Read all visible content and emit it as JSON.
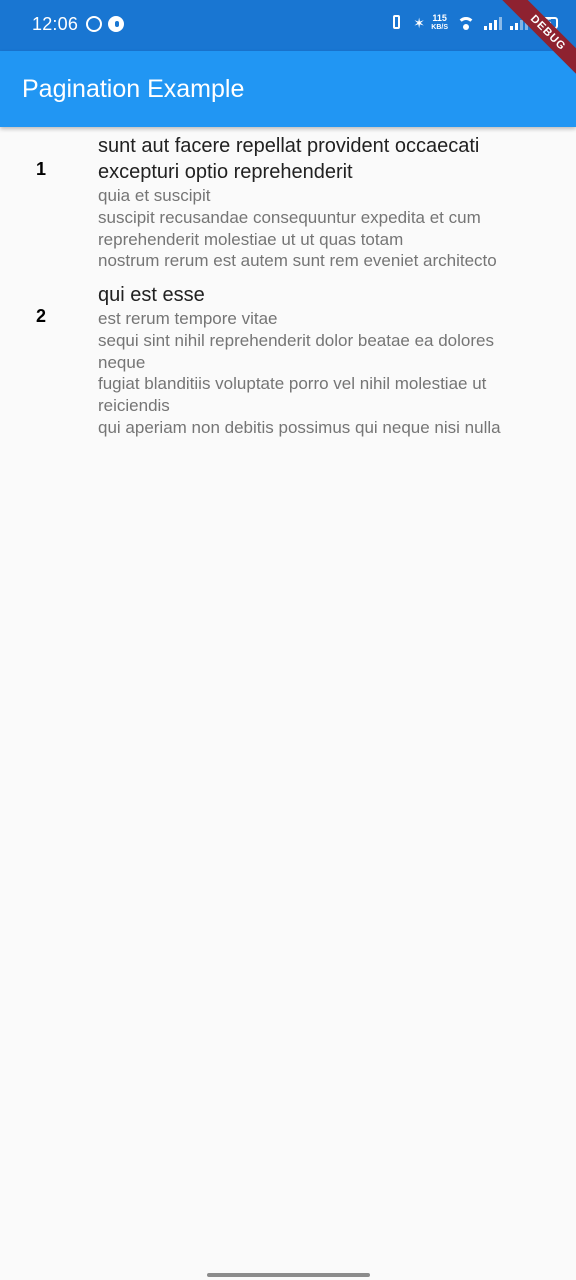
{
  "status_bar": {
    "time": "12:06",
    "left_icons": [
      "whatsapp-icon",
      "notification-app-icon"
    ],
    "right_icons": [
      "vibrate-icon",
      "bluetooth-icon",
      "wifi-icon",
      "signal-icon",
      "signal-weak-icon",
      "battery-icon"
    ],
    "network_speed_value": "115",
    "network_speed_unit": "KB/S",
    "battery_level": "55"
  },
  "debug_banner": "DEBUG",
  "app_bar": {
    "title": "Pagination Example"
  },
  "colors": {
    "status_bar": "#1976d2",
    "app_bar": "#2196f3",
    "background": "#fafafa",
    "title_text": "#212121",
    "body_text": "#757575",
    "debug_banner": "#8e2230"
  },
  "posts": [
    {
      "index": "1",
      "title": "sunt aut facere repellat provident occaecati\nexcepturi optio reprehenderit",
      "body": "quia et suscipit\nsuscipit recusandae consequuntur expedita et cum\nreprehenderit molestiae ut ut quas totam\nnostrum rerum est autem sunt rem eveniet architecto"
    },
    {
      "index": "2",
      "title": "qui est esse",
      "body": "est rerum tempore vitae\nsequi sint nihil reprehenderit dolor beatae ea dolores\nneque\nfugiat blanditiis voluptate porro vel nihil molestiae ut\nreiciendis\nqui aperiam non debitis possimus qui neque nisi nulla"
    }
  ]
}
